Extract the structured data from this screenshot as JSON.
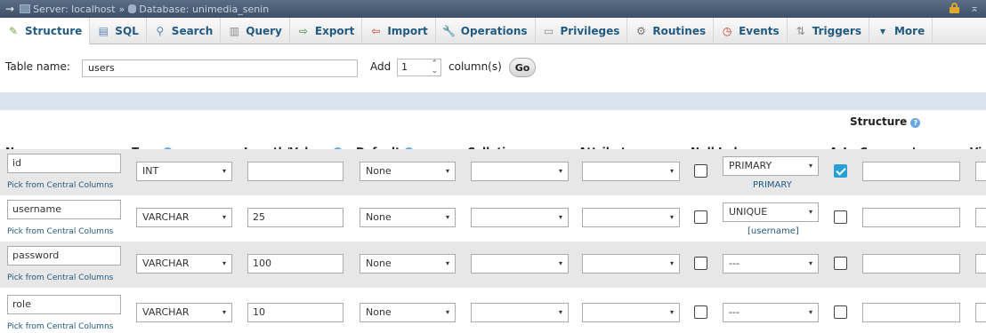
{
  "titlebar": {
    "arrow": "→",
    "server": "Server: localhost",
    "separator": "»",
    "database": "Database: unimedia_senin",
    "collapse": "⌅"
  },
  "tabs": [
    {
      "label": "Structure",
      "icon": "structure-icon",
      "glyph": "✎"
    },
    {
      "label": "SQL",
      "icon": "sql-icon",
      "glyph": "▤"
    },
    {
      "label": "Search",
      "icon": "search-icon",
      "glyph": "⚲"
    },
    {
      "label": "Query",
      "icon": "query-icon",
      "glyph": "▥"
    },
    {
      "label": "Export",
      "icon": "export-icon",
      "glyph": "⇨"
    },
    {
      "label": "Import",
      "icon": "import-icon",
      "glyph": "⇦"
    },
    {
      "label": "Operations",
      "icon": "operations-icon",
      "glyph": "🔧"
    },
    {
      "label": "Privileges",
      "icon": "privileges-icon",
      "glyph": "▭"
    },
    {
      "label": "Routines",
      "icon": "routines-icon",
      "glyph": "⚙"
    },
    {
      "label": "Events",
      "icon": "events-icon",
      "glyph": "◷"
    },
    {
      "label": "Triggers",
      "icon": "triggers-icon",
      "glyph": "⇅"
    },
    {
      "label": "More",
      "icon": "more-icon",
      "glyph": "▾"
    }
  ],
  "form": {
    "table_name_label": "Table name:",
    "table_name_value": "users",
    "add_label": "Add",
    "add_count": "1",
    "columns_label": "column(s)",
    "go_label": "Go"
  },
  "structure_label": "Structure",
  "headers": {
    "name": "Name",
    "type": "Type",
    "length": "Length/Values",
    "default": "Default",
    "collation": "Collation",
    "attributes": "Attributes",
    "null": "Null",
    "index": "Index",
    "ai": "A_I",
    "comments": "Comments",
    "virtuality": "Vir"
  },
  "pick_label": "Pick from Central Columns",
  "rows": [
    {
      "name": "id",
      "type": "INT",
      "length": "",
      "default": "None",
      "index": "PRIMARY",
      "index_sub": "PRIMARY",
      "ai": true,
      "null": false
    },
    {
      "name": "username",
      "type": "VARCHAR",
      "length": "25",
      "default": "None",
      "index": "UNIQUE",
      "index_sub": "[username]",
      "ai": false,
      "null": false
    },
    {
      "name": "password",
      "type": "VARCHAR",
      "length": "100",
      "default": "None",
      "index": "---",
      "index_sub": "",
      "ai": false,
      "null": false
    },
    {
      "name": "role",
      "type": "VARCHAR",
      "length": "10",
      "default": "None",
      "index": "---",
      "index_sub": "",
      "ai": false,
      "null": false
    }
  ]
}
